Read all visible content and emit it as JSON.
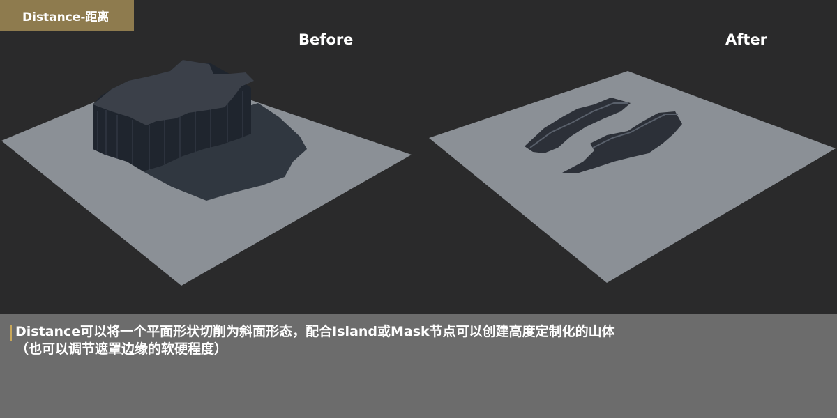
{
  "header": {
    "title_tag": "Distance-距离",
    "accent_color": "#8e7b4e"
  },
  "panels": {
    "before_label": "Before",
    "after_label": "After"
  },
  "caption": {
    "line1": "Distance可以将一个平面形状切削为斜面形态，配合Island或Mask节点可以创建高度定制化的山体",
    "line2": "（也可以调节遮罩边缘的软硬程度）",
    "accent_color": "#c9a85a",
    "background_color": "#6c6c6c"
  },
  "colors": {
    "viewport_bg": "#2a2a2b",
    "plane_fill": "#8b9096",
    "rock_dark": "#22272f"
  }
}
